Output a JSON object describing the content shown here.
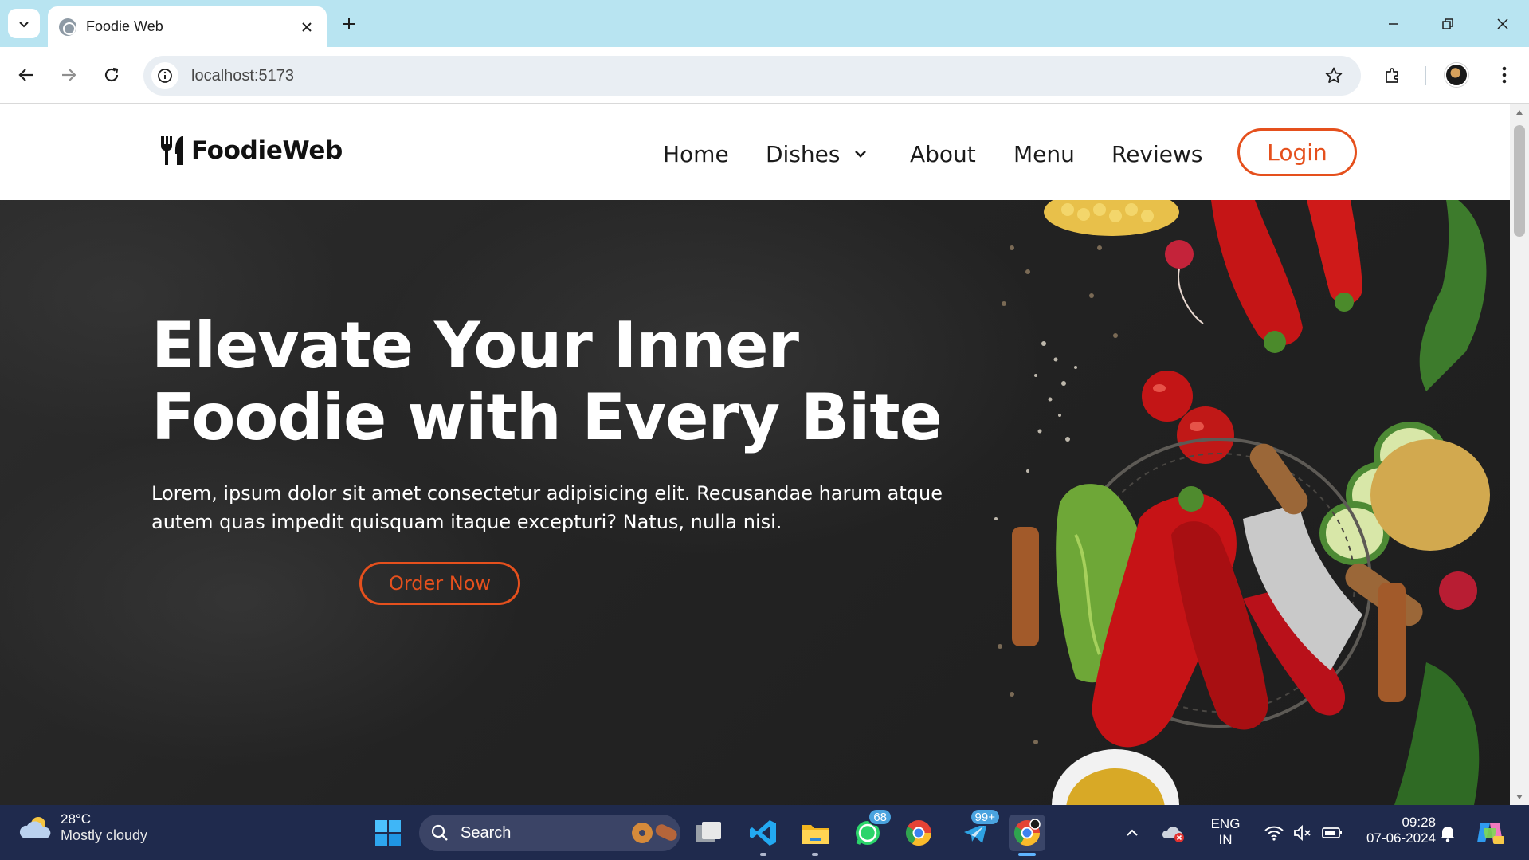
{
  "browser": {
    "tab_title": "Foodie Web",
    "url": "localhost:5173"
  },
  "site": {
    "logo_text": "FoodieWeb",
    "nav": {
      "home": "Home",
      "dishes": "Dishes",
      "about": "About",
      "menu": "Menu",
      "reviews": "Reviews",
      "login": "Login"
    },
    "hero": {
      "title_line1": "Elevate Your Inner",
      "title_line2": "Foodie with Every Bite",
      "subtitle": "Lorem, ipsum dolor sit amet consectetur adipisicing elit. Recusandae harum atque autem quas impedit quisquam itaque excepturi? Natus, nulla nisi.",
      "cta": "Order Now"
    },
    "colors": {
      "accent": "#e5501d",
      "header_bg": "#ffffff",
      "hero_bg": "#252525"
    }
  },
  "taskbar": {
    "weather": {
      "temp": "28°C",
      "desc": "Mostly cloudy"
    },
    "search_placeholder": "Search",
    "whatsapp_badge": "68",
    "telegram_badge": "99+",
    "lang_top": "ENG",
    "lang_bottom": "IN",
    "time": "09:28",
    "date": "07-06-2024"
  }
}
